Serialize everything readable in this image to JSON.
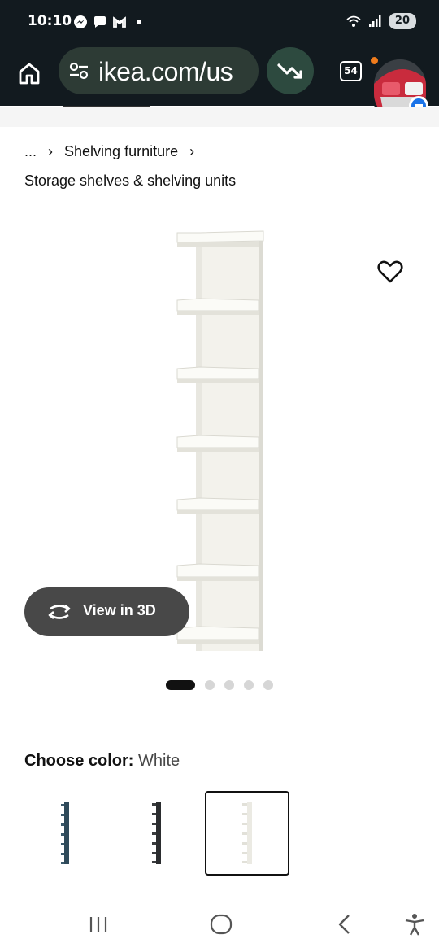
{
  "status": {
    "time": "10:10",
    "battery": "20",
    "icons": [
      "messenger-icon",
      "chat-icon",
      "gmail-icon",
      "dot-icon",
      "wifi-icon",
      "signal-icon",
      "battery-icon"
    ]
  },
  "browser": {
    "url": "ikea.com/us",
    "tab_count": "54",
    "icons": [
      "home-icon",
      "tune-icon",
      "trending-down-icon",
      "tabs-icon",
      "avatar"
    ]
  },
  "breadcrumb": {
    "ellipsis": "...",
    "separator": "›",
    "item": "Shelving furniture"
  },
  "category": "Storage shelves & shelving units",
  "product": {
    "view3d_label": "View in 3D",
    "image_count": 5,
    "active_image": 1
  },
  "color": {
    "label": "Choose color:",
    "value": "White",
    "options": [
      "Blue",
      "Black-brown",
      "White"
    ],
    "selected": "White"
  },
  "colors": {
    "status_bg": "#121a1f",
    "url_bar": "#2d3b35",
    "view3d_bg": "#484848"
  }
}
